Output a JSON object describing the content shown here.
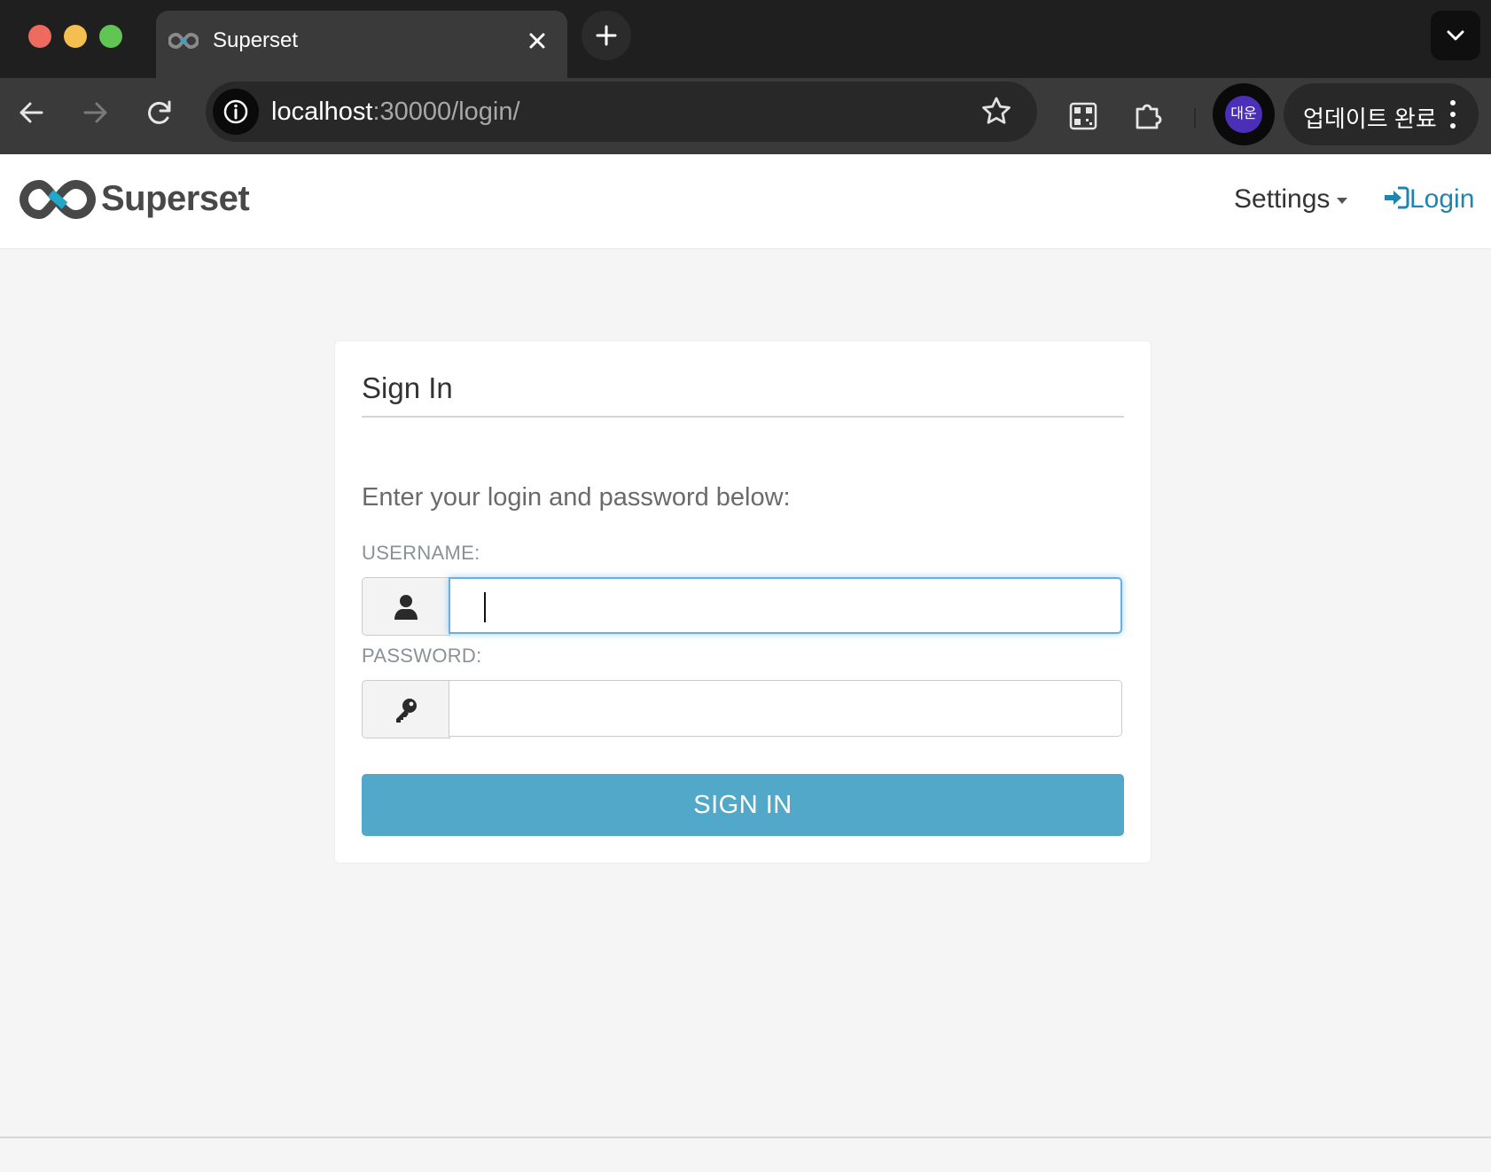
{
  "browser": {
    "tab": {
      "title": "Superset"
    },
    "address": {
      "host": "localhost",
      "rest": ":30000/login/"
    },
    "profile": {
      "initials": "대운"
    },
    "update_label": "업데이트 완료"
  },
  "navbar": {
    "brand": "Superset",
    "settings_label": "Settings",
    "login_label": "Login"
  },
  "login": {
    "title": "Sign In",
    "instructions": "Enter your login and password below:",
    "username_label": "USERNAME:",
    "username_value": "",
    "password_label": "PASSWORD:",
    "password_value": "",
    "submit_label": "SIGN IN"
  },
  "colors": {
    "primary": "#52a8c8",
    "link": "#1f85b0",
    "focus": "#66afe9",
    "background": "#f5f5f5"
  },
  "icons": {
    "username": "user-icon",
    "password": "key-icon",
    "navbar_login": "sign-in-icon"
  }
}
